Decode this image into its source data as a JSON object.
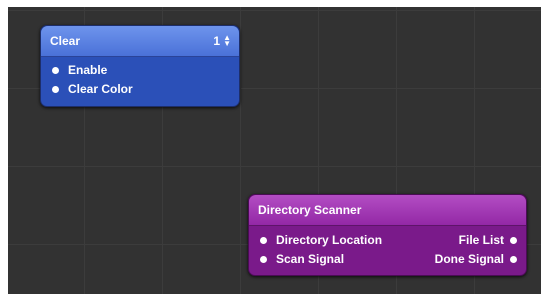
{
  "patches": {
    "clear": {
      "title": "Clear",
      "index_value": "1",
      "inputs": [
        {
          "label": "Enable"
        },
        {
          "label": "Clear Color"
        }
      ],
      "color": "#2b50b8"
    },
    "directory_scanner": {
      "title": "Directory Scanner",
      "inputs": [
        {
          "label": "Directory Location"
        },
        {
          "label": "Scan Signal"
        }
      ],
      "outputs": [
        {
          "label": "File List"
        },
        {
          "label": "Done Signal"
        }
      ],
      "color": "#7a1a8a"
    }
  },
  "icons": {
    "stepper": "up-down-stepper-icon",
    "port": "port-dot-icon"
  }
}
